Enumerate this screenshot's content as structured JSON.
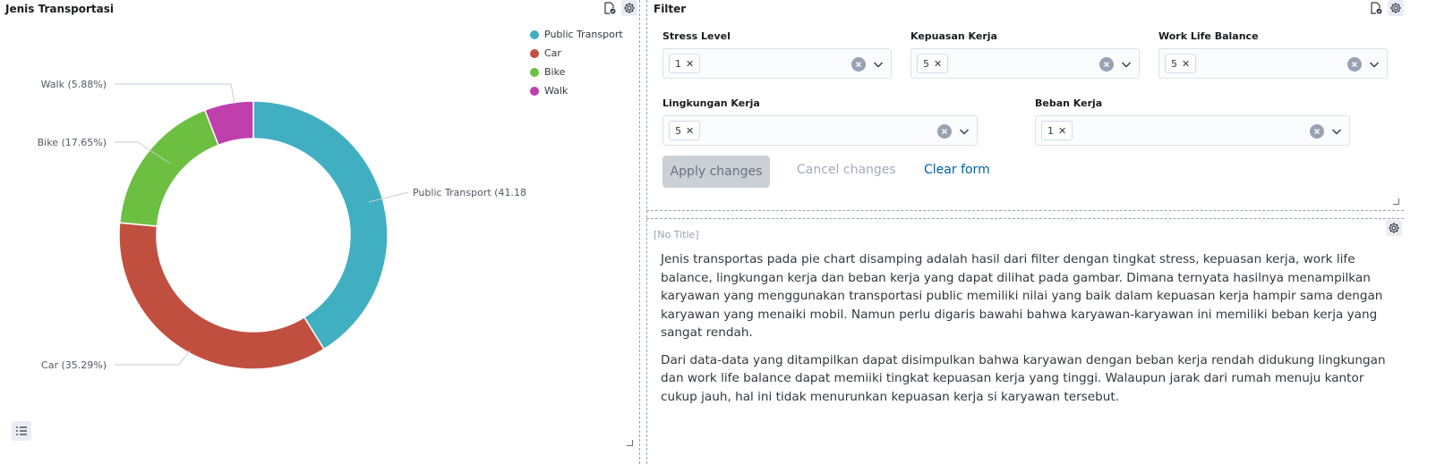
{
  "left_panel": {
    "title": "Jenis Transportasi"
  },
  "filter_panel": {
    "title": "Filter",
    "controls": [
      {
        "label": "Stress Level",
        "value": "1"
      },
      {
        "label": "Kepuasan Kerja",
        "value": "5"
      },
      {
        "label": "Work Life Balance",
        "value": "5"
      },
      {
        "label": "Lingkungan Kerja",
        "value": "5"
      },
      {
        "label": "Beban Kerja",
        "value": "1"
      }
    ],
    "apply_label": "Apply changes",
    "cancel_label": "Cancel changes",
    "clear_label": "Clear form"
  },
  "text_panel": {
    "title": "[No Title]",
    "paragraphs": [
      "Jenis transportas pada pie chart disamping adalah hasil dari filter dengan tingkat stress, kepuasan kerja, work life balance, lingkungan kerja dan beban kerja yang dapat dilihat pada gambar. Dimana ternyata hasilnya menampilkan karyawan yang menggunakan transportasi public memiliki nilai yang baik dalam kepuasan kerja hampir sama dengan karyawan yang menaiki mobil. Namun perlu digaris bawahi bahwa karyawan-karyawan ini memiliki beban kerja yang sangat rendah.",
      "Dari data-data yang ditampilkan dapat disimpulkan bahwa karyawan dengan beban kerja rendah didukung lingkungan dan work life balance dapat memiiki tingkat kepuasan kerja yang tinggi. Walaupun jarak dari rumah menuju kantor cukup jauh, hal ini tidak menurunkan kepuasan kerja si karyawan tersebut."
    ]
  },
  "icons": {
    "options_menu": "gear-icon",
    "inspect": "document-check-icon",
    "legend_toggle": "list-icon",
    "clear": "clear-icon",
    "chevron": "chevron-down-icon",
    "remove_pill": "cross-icon"
  },
  "chart_data": {
    "type": "pie",
    "donut": true,
    "title": "Jenis Transportasi",
    "categories": [
      "Public Transport",
      "Car",
      "Bike",
      "Walk"
    ],
    "values": [
      41.18,
      35.29,
      17.65,
      5.88
    ],
    "colors": [
      "#41afc2",
      "#c14f3f",
      "#6cbf40",
      "#bf3fad"
    ],
    "slice_labels": [
      "Public Transport (41.18",
      "Car (35.29%)",
      "Bike (17.65%)",
      "Walk (5.88%)"
    ],
    "legend_position": "top-right"
  }
}
